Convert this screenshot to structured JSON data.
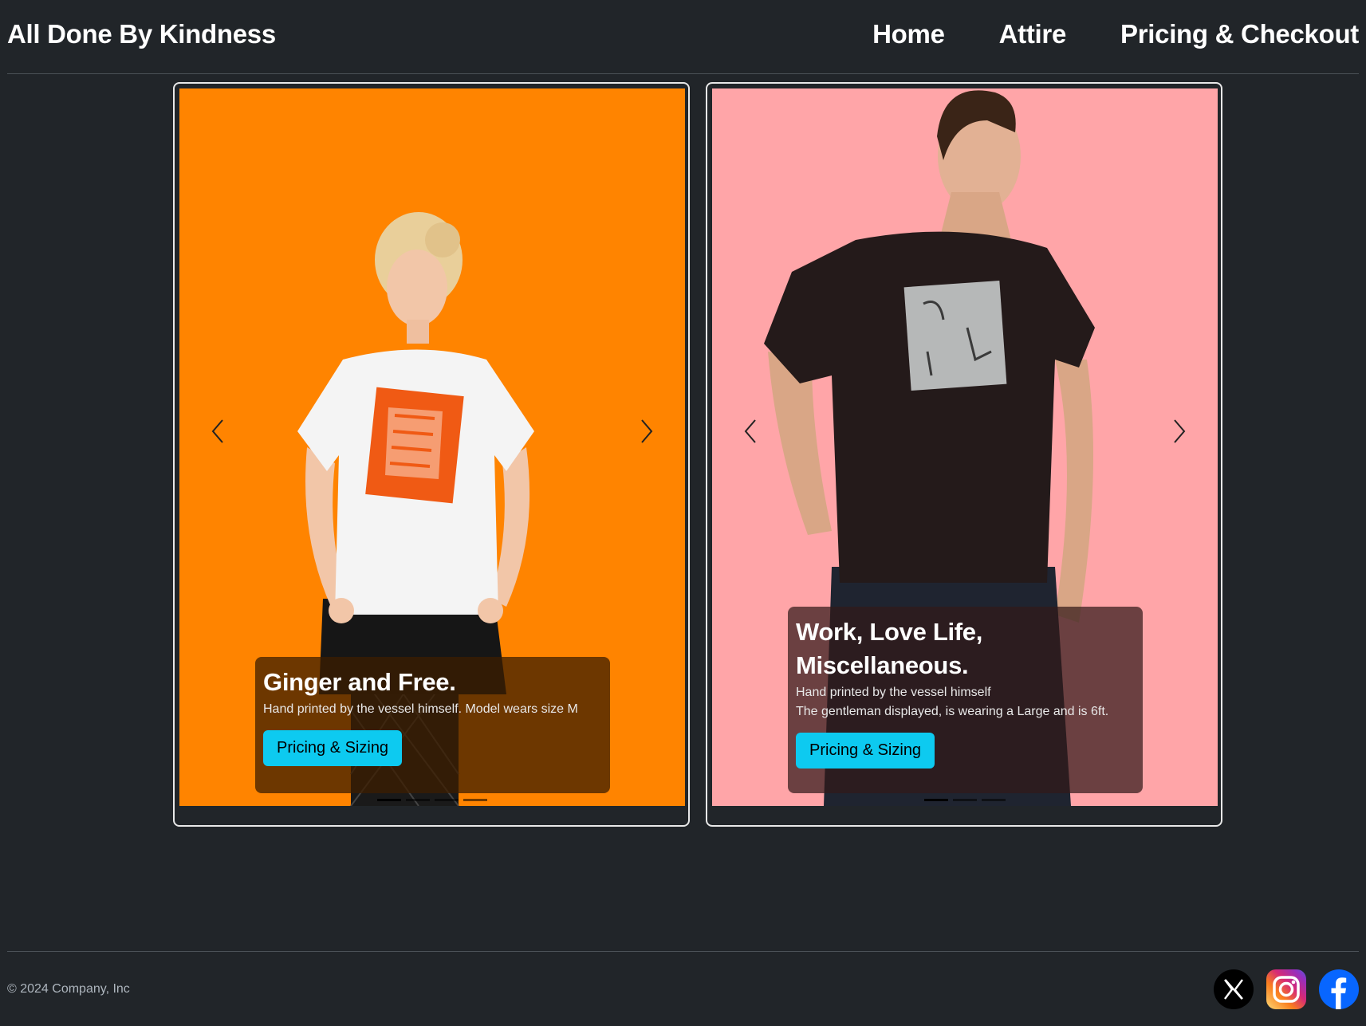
{
  "header": {
    "brand": "All Done By Kindness",
    "nav": [
      "Home",
      "Attire",
      "Pricing & Checkout"
    ]
  },
  "cards": [
    {
      "background": "#ff8400",
      "caption_title": "Ginger and Free.",
      "caption_lines": [
        "Hand printed by the vessel himself. Model wears size M"
      ],
      "button_label": "Pricing & Sizing",
      "indicator_count": 4,
      "active_indicator": 0
    },
    {
      "background": "#ffa5a8",
      "caption_title_lines": [
        "Work, Love Life,",
        "Miscellaneous."
      ],
      "caption_lines": [
        "Hand printed by the vessel himself",
        "The gentleman displayed, is wearing a Large and is 6ft."
      ],
      "button_label": "Pricing & Sizing",
      "indicator_count": 3,
      "active_indicator": 0
    }
  ],
  "footer": {
    "copyright": "© 2024 Company, Inc",
    "socials": [
      "x-icon",
      "instagram-icon",
      "facebook-icon"
    ]
  },
  "colors": {
    "page_bg": "#212529",
    "button_bg": "#0dcaf0",
    "facebook": "#0866ff"
  }
}
